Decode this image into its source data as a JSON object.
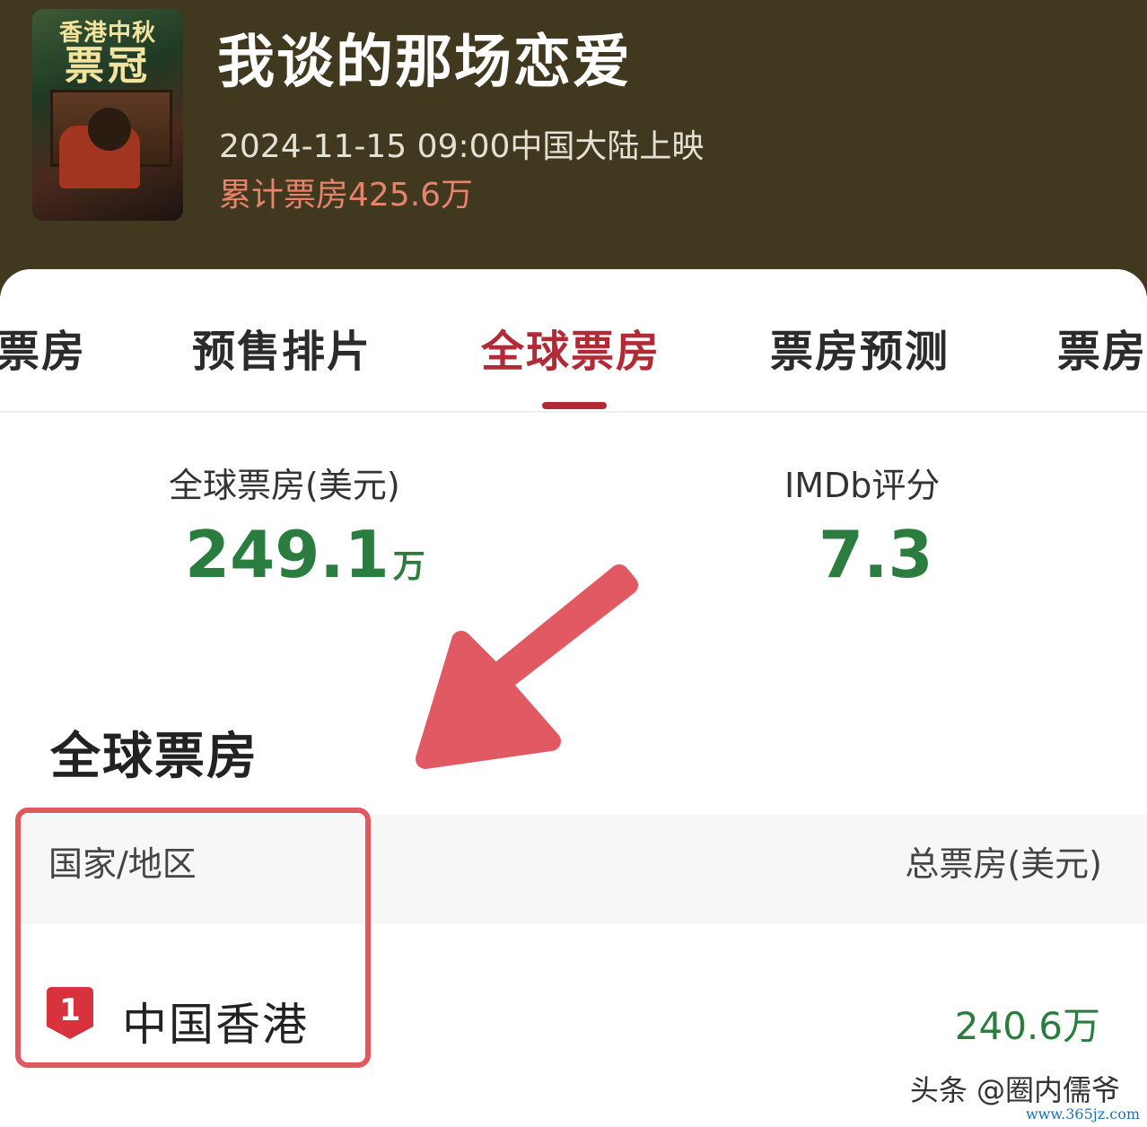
{
  "movie": {
    "poster_badge_line1": "香港中秋",
    "poster_badge_line2": "票冠",
    "title": "我谈的那场恋爱",
    "release": "2024-11-15 09:00中国大陆上映",
    "cumulative_box_office": "累计票房425.6万"
  },
  "tabs": [
    {
      "label": "票房",
      "active": false
    },
    {
      "label": "预售排片",
      "active": false
    },
    {
      "label": "全球票房",
      "active": true
    },
    {
      "label": "票房预测",
      "active": false
    },
    {
      "label": "票房",
      "active": false
    }
  ],
  "stats": {
    "global_label": "全球票房(美元)",
    "global_value": "249.1",
    "global_unit": "万",
    "imdb_label": "IMDb评分",
    "imdb_value": "7.3"
  },
  "section": {
    "title": "全球票房"
  },
  "table": {
    "headers": [
      "国家/地区",
      "总票房(美元)"
    ],
    "rows": [
      {
        "rank": "1",
        "region": "中国香港",
        "box_office": "240.6万"
      }
    ]
  },
  "watermark": {
    "text": "头条 @圈内儒爷",
    "url": "www.365jz.com"
  },
  "colors": {
    "header_bg": "#40391f",
    "accent_red": "#b22a36",
    "value_green": "#2a7d3f",
    "annotation_red": "#e1595f"
  }
}
